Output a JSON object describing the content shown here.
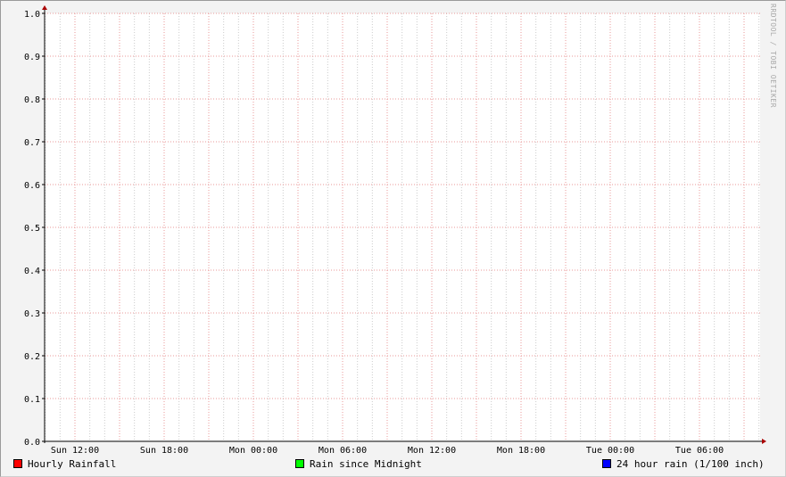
{
  "chart_data": {
    "type": "line",
    "title": "",
    "xlabel": "",
    "ylabel": "",
    "ylim": [
      0.0,
      1.0
    ],
    "y_ticks": [
      "0.0",
      "0.1",
      "0.2",
      "0.3",
      "0.4",
      "0.5",
      "0.6",
      "0.7",
      "0.8",
      "0.9",
      "1.0"
    ],
    "x_ticks": [
      "Sun 12:00",
      "Sun 18:00",
      "Mon 00:00",
      "Mon 06:00",
      "Mon 12:00",
      "Mon 18:00",
      "Tue 00:00",
      "Tue 06:00"
    ],
    "grid": true,
    "legend_position": "bottom",
    "series": [
      {
        "name": "Hourly Rainfall",
        "color": "#ff0000",
        "values": []
      },
      {
        "name": "Rain since Midnight",
        "color": "#00ff00",
        "values": []
      },
      {
        "name": "24 hour rain (1/100 inch)",
        "color": "#0000ff",
        "values": []
      }
    ]
  },
  "watermark": "RRDTOOL / TOBI OETIKER",
  "colors": {
    "grid_major": "#e99a9a",
    "grid_minor": "#cccccc",
    "axis": "#000000",
    "arrow": "#aa0000",
    "canvas": "#ffffff",
    "background": "#f3f3f3"
  }
}
